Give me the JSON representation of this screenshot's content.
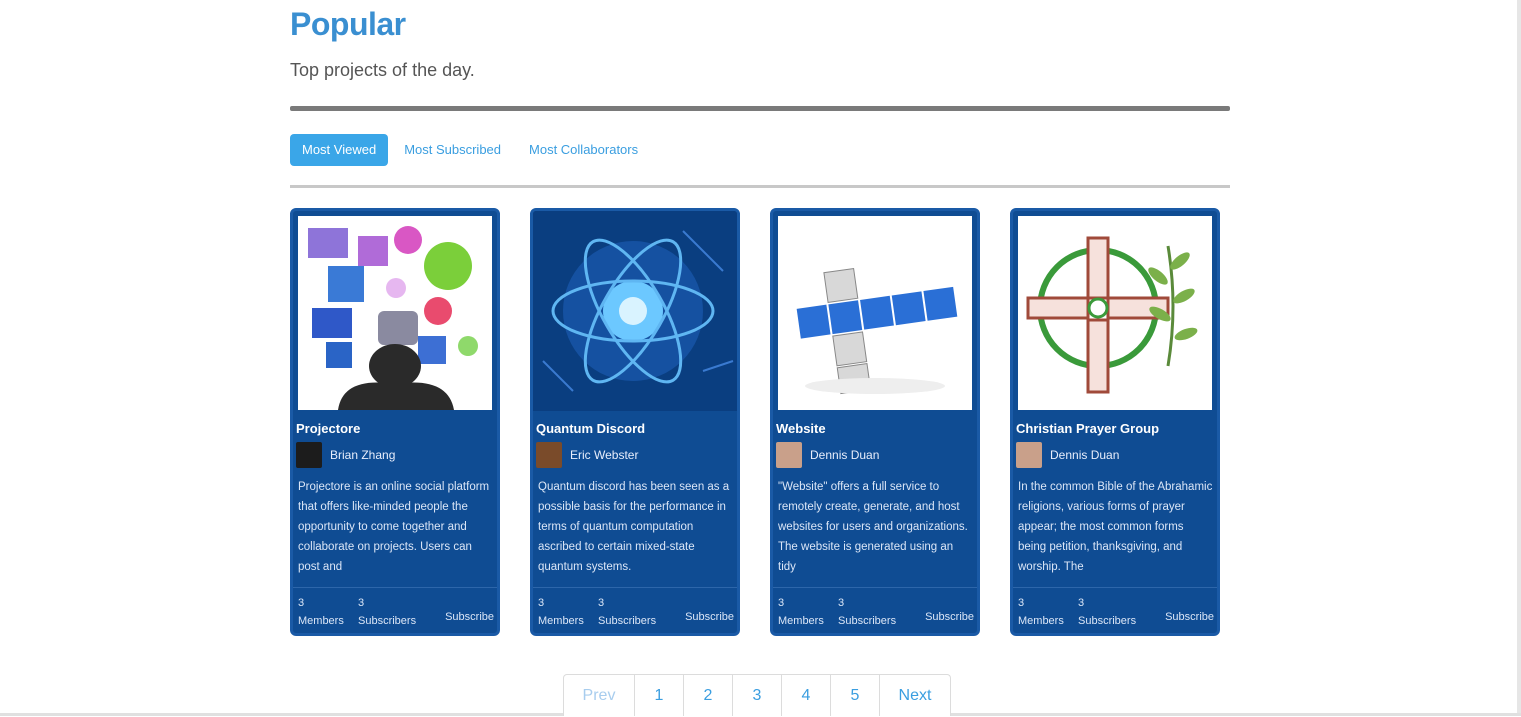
{
  "header": {
    "title": "Popular",
    "subtitle": "Top projects of the day."
  },
  "tabs": [
    {
      "label": "Most Viewed",
      "active": true
    },
    {
      "label": "Most Subscribed",
      "active": false
    },
    {
      "label": "Most Collaborators",
      "active": false
    }
  ],
  "cards": [
    {
      "name": "Projectore",
      "owner": "Brian Zhang",
      "description": "Projectore is an online social platform that offers like-minded people the opportunity to come together and collaborate on projects. Users can post and",
      "members": "3",
      "subscribers": "3",
      "members_label": "Members",
      "subscribers_label": "Subscribers",
      "action_label": "Subscribe"
    },
    {
      "name": "Quantum Discord",
      "owner": "Eric Webster",
      "description": "Quantum discord has been seen as a possible basis for the performance in terms of quantum computation ascribed to certain mixed-state quantum systems.",
      "members": "3",
      "subscribers": "3",
      "members_label": "Members",
      "subscribers_label": "Subscribers",
      "action_label": "Subscribe"
    },
    {
      "name": "Website",
      "owner": "Dennis Duan",
      "description": "\"Website\" offers a full service to remotely create, generate, and host websites for users and organizations. The website is generated using an tidy",
      "members": "3",
      "subscribers": "3",
      "members_label": "Members",
      "subscribers_label": "Subscribers",
      "action_label": "Subscribe"
    },
    {
      "name": "Christian Prayer Group",
      "owner": "Dennis Duan",
      "description": "In the common Bible of the Abrahamic religions, various forms of prayer appear; the most common forms being petition, thanksgiving, and worship. The",
      "members": "3",
      "subscribers": "3",
      "members_label": "Members",
      "subscribers_label": "Subscribers",
      "action_label": "Subscribe"
    }
  ],
  "pagination": {
    "prev": "Prev",
    "pages": [
      "1",
      "2",
      "3",
      "4",
      "5"
    ],
    "next": "Next"
  },
  "colors": {
    "accent": "#3a8fd1",
    "card_bg": "#0f4c93",
    "tab_active": "#3aa6e8"
  }
}
